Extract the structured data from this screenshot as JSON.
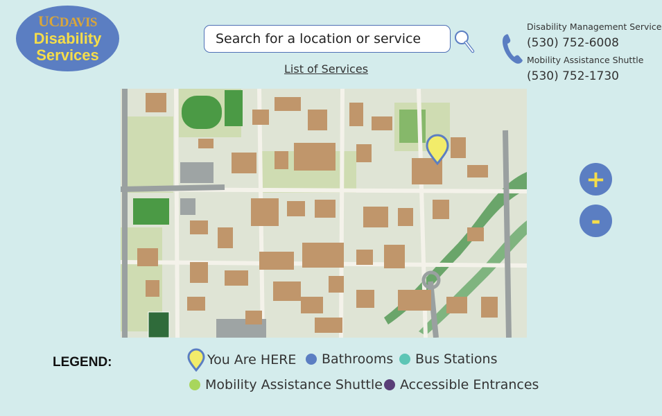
{
  "logo": {
    "brand_uc": "UC",
    "brand_davis": "DAVIS",
    "line1": "Disability",
    "line2": "Services"
  },
  "search": {
    "placeholder": "Search for a location or service"
  },
  "services_link": "List of Services",
  "contacts": [
    {
      "label": "Disability Management Services",
      "phone": "(530) 752-6008"
    },
    {
      "label": "Mobility Assistance Shuttle",
      "phone": "(530) 752-1730"
    }
  ],
  "zoom": {
    "in_label": "+",
    "out_label": "-"
  },
  "legend": {
    "title": "LEGEND:",
    "items": [
      {
        "label": "You Are HERE",
        "color": "#f2ec6a",
        "icon": "location-pin-icon"
      },
      {
        "label": "Bathrooms",
        "color": "#5b7ec2",
        "icon": "dot-icon"
      },
      {
        "label": "Bus Stations",
        "color": "#5cc5b5",
        "icon": "dot-icon"
      },
      {
        "label": "Mobility Assistance Shuttle",
        "color": "#a8d65d",
        "icon": "dot-icon"
      },
      {
        "label": "Accessible Entrances",
        "color": "#5a3f78",
        "icon": "dot-icon"
      }
    ]
  },
  "colors": {
    "background": "#d4ecec",
    "accent": "#5b7ec2",
    "highlight": "#f5dd4a"
  }
}
